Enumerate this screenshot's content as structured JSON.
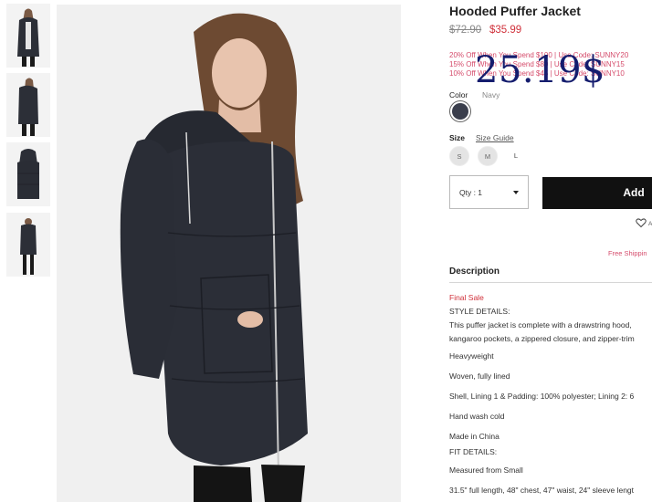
{
  "product": {
    "title": "Hooded Puffer Jacket",
    "price_original": "$72.90",
    "price_sale": "$35.99",
    "overlay_price": "25.19$"
  },
  "promos": [
    "20% Off When You Spend $100 | Use Code: SUNNY20",
    "15% Off When You Spend $80 | Use Code: SUNNY15",
    "10% Off When You Spend $45 | Use Code: SUNNY10"
  ],
  "color": {
    "label": "Color",
    "value": "Navy",
    "swatch_hex": "#3a3e4c"
  },
  "size": {
    "label": "Size",
    "guide": "Size Guide",
    "options": [
      "S",
      "M",
      "L"
    ]
  },
  "quantity": {
    "label": "Qty : 1"
  },
  "add_button": "Add",
  "wishlist_text": "A",
  "shipping_text": "Free Shippin",
  "description": {
    "heading": "Description",
    "final_sale": "Final Sale",
    "style_heading": "STYLE DETAILS:",
    "style_text_1": "This puffer jacket is complete with a drawstring hood,",
    "style_text_2": "kangaroo pockets, a zippered closure, and zipper-trim",
    "weight": "Heavyweight",
    "fabric": "Woven, fully lined",
    "content": "Shell, Lining 1 & Padding: 100% polyester; Lining 2: 6",
    "care": "Hand wash cold",
    "origin": "Made in China",
    "fit_heading": "FIT DETAILS:",
    "measured": "Measured from Small",
    "measurements": "31.5\" full length, 48\" chest, 47\" waist, 24\" sleeve lengt"
  },
  "colors": {
    "sale_red": "#d0303a",
    "promo_pink": "#d54b6b",
    "overlay_navy": "#151d6e",
    "button_black": "#111111"
  },
  "icons": [
    "heart-icon",
    "chevron-down-icon"
  ]
}
